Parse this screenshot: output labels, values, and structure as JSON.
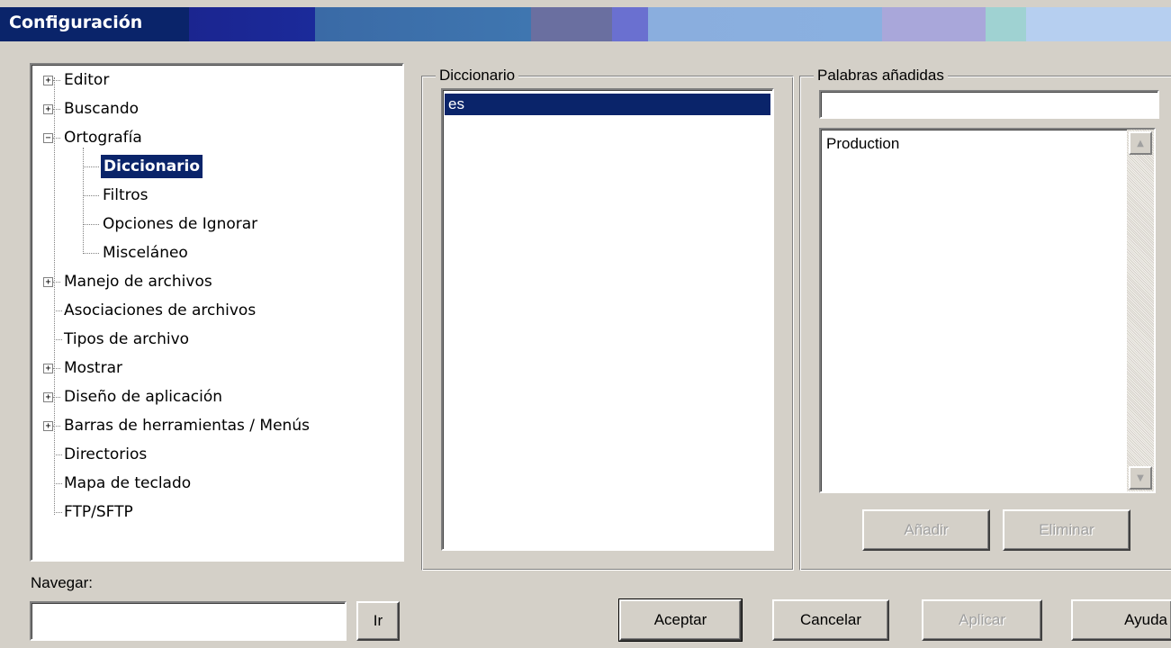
{
  "window": {
    "title": "Configuración"
  },
  "tree": {
    "items": [
      {
        "label": "Editor",
        "expander": "+"
      },
      {
        "label": "Buscando",
        "expander": "+"
      },
      {
        "label": "Ortografía",
        "expander": "−"
      },
      {
        "label": "Diccionario",
        "selected": true
      },
      {
        "label": "Filtros"
      },
      {
        "label": "Opciones de Ignorar"
      },
      {
        "label": "Misceláneo"
      },
      {
        "label": "Manejo de archivos",
        "expander": "+"
      },
      {
        "label": "Asociaciones de archivos"
      },
      {
        "label": "Tipos de archivo"
      },
      {
        "label": "Mostrar",
        "expander": "+"
      },
      {
        "label": "Diseño de aplicación",
        "expander": "+"
      },
      {
        "label": "Barras de herramientas / Menús",
        "expander": "+"
      },
      {
        "label": "Directorios"
      },
      {
        "label": "Mapa de teclado"
      },
      {
        "label": "FTP/SFTP"
      }
    ]
  },
  "dictionary": {
    "legend": "Diccionario",
    "items": [
      "es"
    ],
    "selected": "es"
  },
  "added_words": {
    "legend": "Palabras añadidas",
    "input_value": "",
    "items": [
      "Production"
    ],
    "add_label": "Añadir",
    "remove_label": "Eliminar"
  },
  "navigate": {
    "label": "Navegar:",
    "input_value": "",
    "go_label": "Ir"
  },
  "footer": {
    "ok_label": "Aceptar",
    "cancel_label": "Cancelar",
    "apply_label": "Aplicar",
    "help_label": "Ayuda"
  },
  "colors": {
    "selection": "#0a246a",
    "face": "#d4d0c8"
  }
}
